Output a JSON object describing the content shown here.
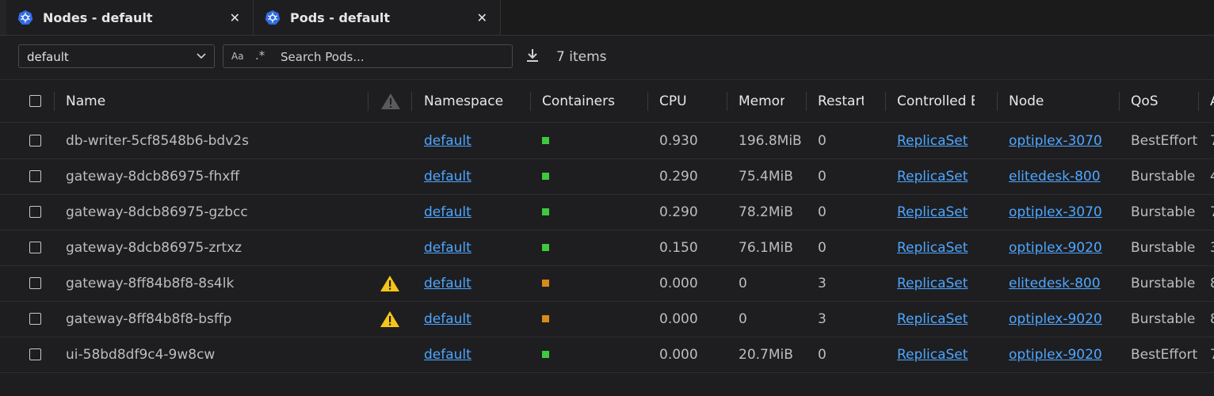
{
  "tabs": [
    {
      "label": "Nodes - default",
      "icon": "kubernetes-icon"
    },
    {
      "label": "Pods - default",
      "icon": "kubernetes-icon"
    }
  ],
  "toolbar": {
    "namespace": "default",
    "search_case_label": "Aa",
    "search_regex_label": ".*",
    "search_placeholder": "Search Pods...",
    "item_count": "7 items"
  },
  "columns": {
    "name": "Name",
    "namespace": "Namespace",
    "containers": "Containers",
    "cpu": "CPU",
    "memory": "Memory",
    "restarts": "Restarts",
    "controlled_by": "Controlled By",
    "node": "Node",
    "qos": "QoS",
    "age": "Age"
  },
  "colors": {
    "running": "#3ec93e",
    "waiting": "#d98b1a",
    "warning": "#f5c518",
    "link": "#4ea6ff"
  },
  "rows": [
    {
      "name": "db-writer-5cf8548b6-bdv2s",
      "warning": false,
      "namespace": "default",
      "container_status": "running",
      "cpu": "0.930",
      "memory": "196.8MiB",
      "restarts": "0",
      "controlled_by": "ReplicaSet",
      "node": "optiplex-3070",
      "qos": "BestEffort",
      "age": "7"
    },
    {
      "name": "gateway-8dcb86975-fhxff",
      "warning": false,
      "namespace": "default",
      "container_status": "running",
      "cpu": "0.290",
      "memory": "75.4MiB",
      "restarts": "0",
      "controlled_by": "ReplicaSet",
      "node": "elitedesk-800",
      "qos": "Burstable",
      "age": "4"
    },
    {
      "name": "gateway-8dcb86975-gzbcc",
      "warning": false,
      "namespace": "default",
      "container_status": "running",
      "cpu": "0.290",
      "memory": "78.2MiB",
      "restarts": "0",
      "controlled_by": "ReplicaSet",
      "node": "optiplex-3070",
      "qos": "Burstable",
      "age": "7"
    },
    {
      "name": "gateway-8dcb86975-zrtxz",
      "warning": false,
      "namespace": "default",
      "container_status": "running",
      "cpu": "0.150",
      "memory": "76.1MiB",
      "restarts": "0",
      "controlled_by": "ReplicaSet",
      "node": "optiplex-9020",
      "qos": "Burstable",
      "age": "3"
    },
    {
      "name": "gateway-8ff84b8f8-8s4lk",
      "warning": true,
      "namespace": "default",
      "container_status": "waiting",
      "cpu": "0.000",
      "memory": "0",
      "restarts": "3",
      "controlled_by": "ReplicaSet",
      "node": "elitedesk-800",
      "qos": "Burstable",
      "age": "8"
    },
    {
      "name": "gateway-8ff84b8f8-bsffp",
      "warning": true,
      "namespace": "default",
      "container_status": "waiting",
      "cpu": "0.000",
      "memory": "0",
      "restarts": "3",
      "controlled_by": "ReplicaSet",
      "node": "optiplex-9020",
      "qos": "Burstable",
      "age": "8"
    },
    {
      "name": "ui-58bd8df9c4-9w8cw",
      "warning": false,
      "namespace": "default",
      "container_status": "running",
      "cpu": "0.000",
      "memory": "20.7MiB",
      "restarts": "0",
      "controlled_by": "ReplicaSet",
      "node": "optiplex-9020",
      "qos": "BestEffort",
      "age": "7"
    }
  ]
}
